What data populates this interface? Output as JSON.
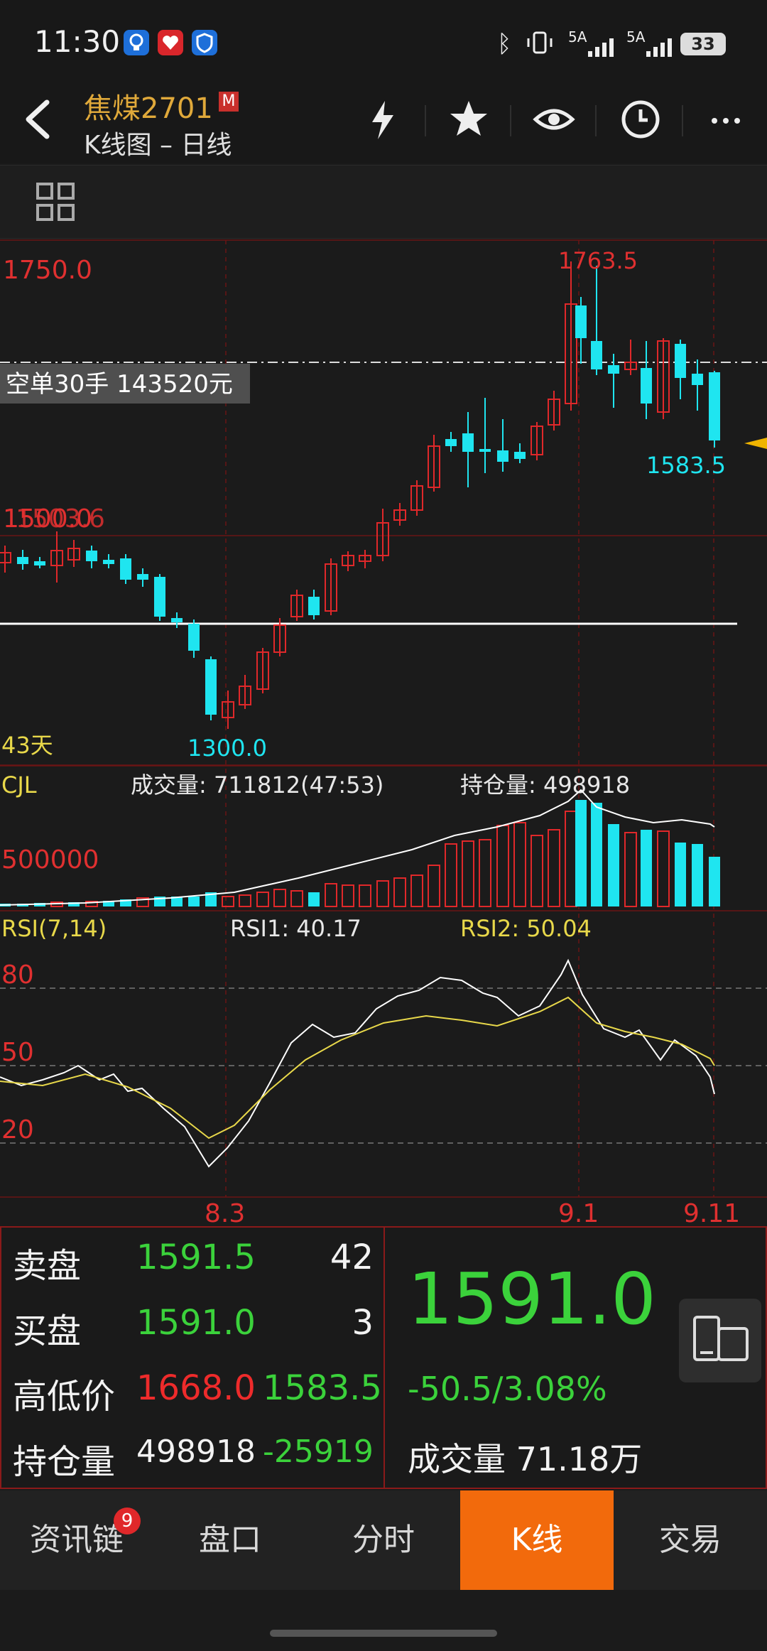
{
  "status_bar": {
    "time": "11:30",
    "signal_1": "5A",
    "signal_2": "5A",
    "battery": "33"
  },
  "header": {
    "back_icon": "chevron-left-icon",
    "symbol": "焦煤2701",
    "badge": "M",
    "subtitle": "K线图 – 日线",
    "actions": [
      "flash-icon",
      "star-icon",
      "eye-icon",
      "clock-icon",
      "more-icon"
    ]
  },
  "toolbar": {
    "icon": "grid-icon"
  },
  "colors": {
    "up": "#e0282a",
    "down": "#1fe5f0",
    "accent": "#f26a0c",
    "price_green": "#3bd23b",
    "symbol": "#e0a93a"
  },
  "kline": {
    "y_labels": {
      "top": "1750.0",
      "mid": "1500.0",
      "mid_overlay": "1503.6"
    },
    "high_label": "1763.5",
    "low_label": "1300.0",
    "last_low_label": "1583.5",
    "order_tag": "空单30手  143520元",
    "days_label": "43天"
  },
  "volume": {
    "name": "CJL",
    "volume_text": "成交量: 711812(47:53)",
    "open_interest_text": "持仓量: 498918",
    "y_label": "500000"
  },
  "rsi": {
    "name": "RSI(7,14)",
    "rsi1_text": "RSI1: 40.17",
    "rsi2_text": "RSI2: 50.04",
    "levels": [
      "80",
      "50",
      "20"
    ]
  },
  "x_axis": {
    "dates": [
      "8.3",
      "9.1",
      "9.11"
    ]
  },
  "quote": {
    "sell_label": "卖盘",
    "sell_price": "1591.5",
    "sell_qty": "42",
    "buy_label": "买盘",
    "buy_price": "1591.0",
    "buy_qty": "3",
    "hilo_label": "高低价",
    "high": "1668.0",
    "low": "1583.5",
    "oi_label": "持仓量",
    "oi": "498918",
    "oi_change": "-25919",
    "last_price": "1591.0",
    "change": "-50.5/3.08%",
    "volume": "成交量 71.18万"
  },
  "tabs": [
    {
      "label": "资讯链",
      "badge": "9"
    },
    {
      "label": "盘口"
    },
    {
      "label": "分时"
    },
    {
      "label": "K线",
      "active": true
    },
    {
      "label": "交易"
    }
  ]
}
